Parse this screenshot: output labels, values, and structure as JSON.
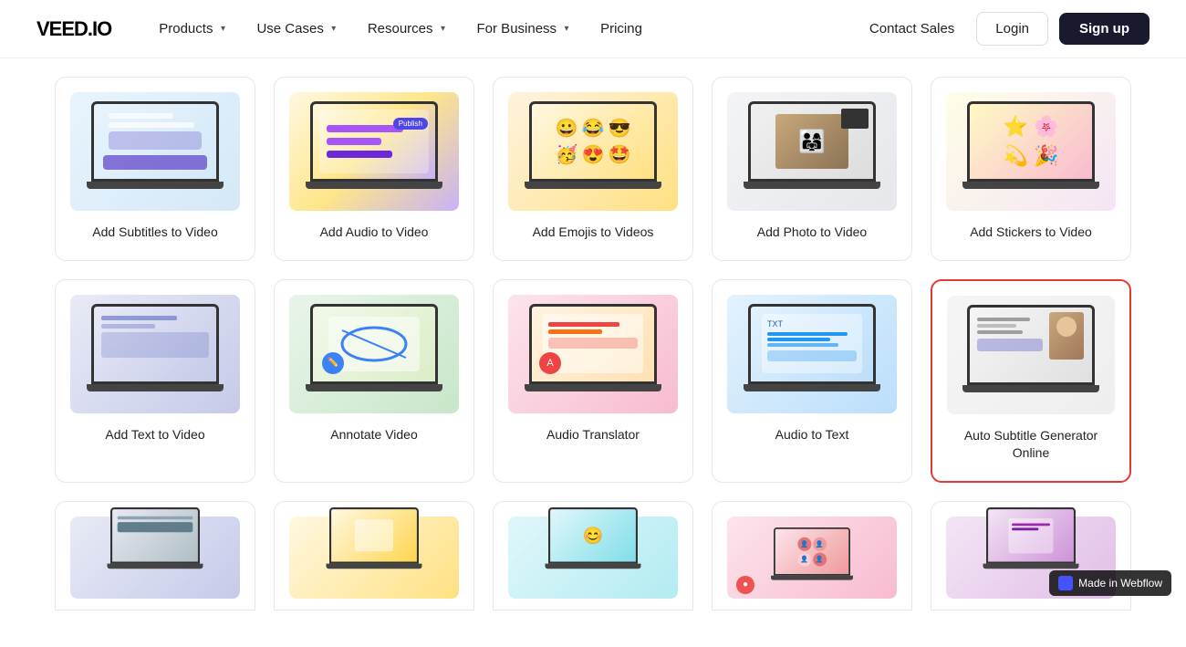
{
  "logo": "VEED.IO",
  "nav": {
    "items": [
      {
        "label": "Products",
        "hasChevron": true
      },
      {
        "label": "Use Cases",
        "hasChevron": true
      },
      {
        "label": "Resources",
        "hasChevron": true
      },
      {
        "label": "For Business",
        "hasChevron": true
      },
      {
        "label": "Pricing",
        "hasChevron": false
      }
    ],
    "contactSales": "Contact Sales",
    "login": "Login",
    "signup": "Sign up"
  },
  "row1": [
    {
      "label": "Add Subtitles to Video",
      "screen": "subtitles",
      "highlighted": false
    },
    {
      "label": "Add Audio to Video",
      "screen": "audio",
      "highlighted": false
    },
    {
      "label": "Add Emojis to Videos",
      "screen": "emoji",
      "highlighted": false
    },
    {
      "label": "Add Photo to Video",
      "screen": "photo",
      "highlighted": false
    },
    {
      "label": "Add Stickers to Video",
      "screen": "stickers",
      "highlighted": false
    }
  ],
  "row2": [
    {
      "label": "Add Text to Video",
      "screen": "text",
      "highlighted": false
    },
    {
      "label": "Annotate Video",
      "screen": "annotate",
      "highlighted": false
    },
    {
      "label": "Audio Translator",
      "screen": "translator",
      "highlighted": false
    },
    {
      "label": "Audio to Text",
      "screen": "a2t",
      "highlighted": false
    },
    {
      "label": "Auto Subtitle Generator Online",
      "screen": "autosub",
      "highlighted": true
    }
  ],
  "row3": [
    {
      "label": "",
      "screen": "bottom1",
      "highlighted": false
    },
    {
      "label": "",
      "screen": "bottom2",
      "highlighted": false
    },
    {
      "label": "",
      "screen": "bottom3",
      "highlighted": false
    },
    {
      "label": "",
      "screen": "bottom4",
      "highlighted": false
    },
    {
      "label": "",
      "screen": "bottom5",
      "highlighted": false
    }
  ],
  "webflow": "Made in Webflow"
}
